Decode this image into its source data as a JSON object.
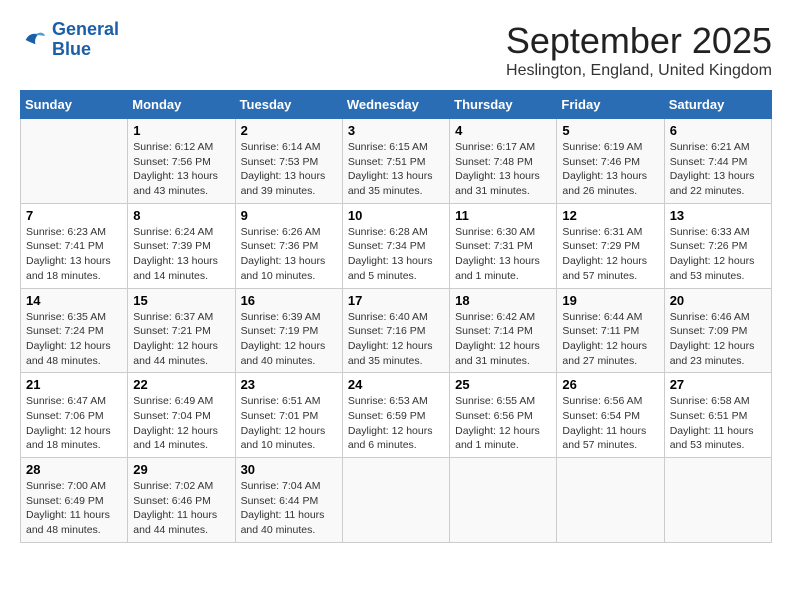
{
  "header": {
    "logo": "GeneralBlue",
    "month": "September 2025",
    "location": "Heslington, England, United Kingdom"
  },
  "days_of_week": [
    "Sunday",
    "Monday",
    "Tuesday",
    "Wednesday",
    "Thursday",
    "Friday",
    "Saturday"
  ],
  "weeks": [
    [
      {
        "day": "",
        "info": ""
      },
      {
        "day": "1",
        "info": "Sunrise: 6:12 AM\nSunset: 7:56 PM\nDaylight: 13 hours and 43 minutes."
      },
      {
        "day": "2",
        "info": "Sunrise: 6:14 AM\nSunset: 7:53 PM\nDaylight: 13 hours and 39 minutes."
      },
      {
        "day": "3",
        "info": "Sunrise: 6:15 AM\nSunset: 7:51 PM\nDaylight: 13 hours and 35 minutes."
      },
      {
        "day": "4",
        "info": "Sunrise: 6:17 AM\nSunset: 7:48 PM\nDaylight: 13 hours and 31 minutes."
      },
      {
        "day": "5",
        "info": "Sunrise: 6:19 AM\nSunset: 7:46 PM\nDaylight: 13 hours and 26 minutes."
      },
      {
        "day": "6",
        "info": "Sunrise: 6:21 AM\nSunset: 7:44 PM\nDaylight: 13 hours and 22 minutes."
      }
    ],
    [
      {
        "day": "7",
        "info": "Sunrise: 6:23 AM\nSunset: 7:41 PM\nDaylight: 13 hours and 18 minutes."
      },
      {
        "day": "8",
        "info": "Sunrise: 6:24 AM\nSunset: 7:39 PM\nDaylight: 13 hours and 14 minutes."
      },
      {
        "day": "9",
        "info": "Sunrise: 6:26 AM\nSunset: 7:36 PM\nDaylight: 13 hours and 10 minutes."
      },
      {
        "day": "10",
        "info": "Sunrise: 6:28 AM\nSunset: 7:34 PM\nDaylight: 13 hours and 5 minutes."
      },
      {
        "day": "11",
        "info": "Sunrise: 6:30 AM\nSunset: 7:31 PM\nDaylight: 13 hours and 1 minute."
      },
      {
        "day": "12",
        "info": "Sunrise: 6:31 AM\nSunset: 7:29 PM\nDaylight: 12 hours and 57 minutes."
      },
      {
        "day": "13",
        "info": "Sunrise: 6:33 AM\nSunset: 7:26 PM\nDaylight: 12 hours and 53 minutes."
      }
    ],
    [
      {
        "day": "14",
        "info": "Sunrise: 6:35 AM\nSunset: 7:24 PM\nDaylight: 12 hours and 48 minutes."
      },
      {
        "day": "15",
        "info": "Sunrise: 6:37 AM\nSunset: 7:21 PM\nDaylight: 12 hours and 44 minutes."
      },
      {
        "day": "16",
        "info": "Sunrise: 6:39 AM\nSunset: 7:19 PM\nDaylight: 12 hours and 40 minutes."
      },
      {
        "day": "17",
        "info": "Sunrise: 6:40 AM\nSunset: 7:16 PM\nDaylight: 12 hours and 35 minutes."
      },
      {
        "day": "18",
        "info": "Sunrise: 6:42 AM\nSunset: 7:14 PM\nDaylight: 12 hours and 31 minutes."
      },
      {
        "day": "19",
        "info": "Sunrise: 6:44 AM\nSunset: 7:11 PM\nDaylight: 12 hours and 27 minutes."
      },
      {
        "day": "20",
        "info": "Sunrise: 6:46 AM\nSunset: 7:09 PM\nDaylight: 12 hours and 23 minutes."
      }
    ],
    [
      {
        "day": "21",
        "info": "Sunrise: 6:47 AM\nSunset: 7:06 PM\nDaylight: 12 hours and 18 minutes."
      },
      {
        "day": "22",
        "info": "Sunrise: 6:49 AM\nSunset: 7:04 PM\nDaylight: 12 hours and 14 minutes."
      },
      {
        "day": "23",
        "info": "Sunrise: 6:51 AM\nSunset: 7:01 PM\nDaylight: 12 hours and 10 minutes."
      },
      {
        "day": "24",
        "info": "Sunrise: 6:53 AM\nSunset: 6:59 PM\nDaylight: 12 hours and 6 minutes."
      },
      {
        "day": "25",
        "info": "Sunrise: 6:55 AM\nSunset: 6:56 PM\nDaylight: 12 hours and 1 minute."
      },
      {
        "day": "26",
        "info": "Sunrise: 6:56 AM\nSunset: 6:54 PM\nDaylight: 11 hours and 57 minutes."
      },
      {
        "day": "27",
        "info": "Sunrise: 6:58 AM\nSunset: 6:51 PM\nDaylight: 11 hours and 53 minutes."
      }
    ],
    [
      {
        "day": "28",
        "info": "Sunrise: 7:00 AM\nSunset: 6:49 PM\nDaylight: 11 hours and 48 minutes."
      },
      {
        "day": "29",
        "info": "Sunrise: 7:02 AM\nSunset: 6:46 PM\nDaylight: 11 hours and 44 minutes."
      },
      {
        "day": "30",
        "info": "Sunrise: 7:04 AM\nSunset: 6:44 PM\nDaylight: 11 hours and 40 minutes."
      },
      {
        "day": "",
        "info": ""
      },
      {
        "day": "",
        "info": ""
      },
      {
        "day": "",
        "info": ""
      },
      {
        "day": "",
        "info": ""
      }
    ]
  ]
}
